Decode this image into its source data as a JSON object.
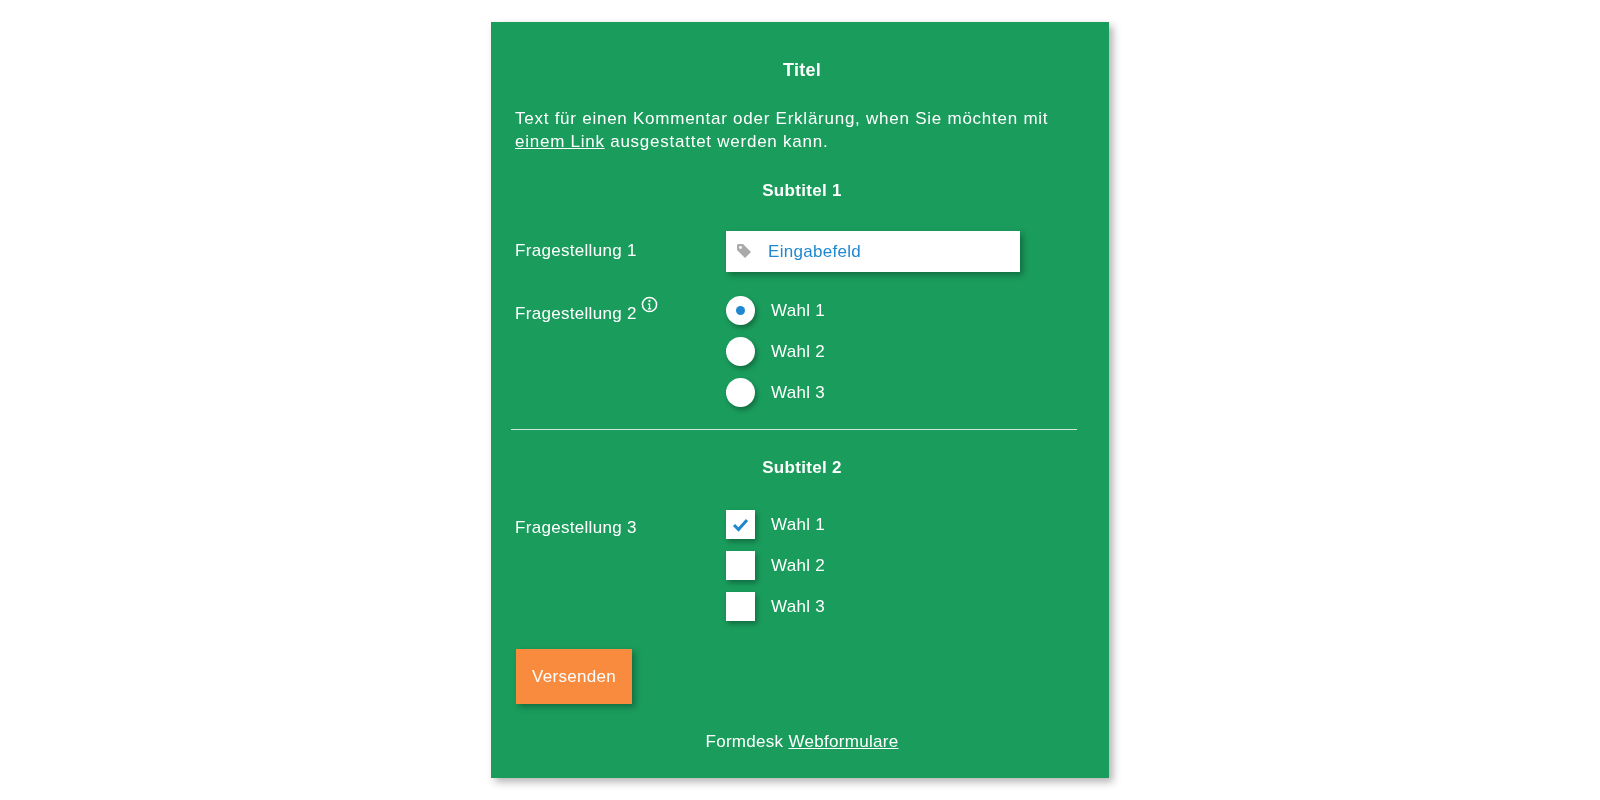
{
  "title": "Titel",
  "intro": {
    "before": "Text für einen Kommentar oder Erklärung, when Sie möchten mit ",
    "link": "einem Link",
    "after": " ausgestattet werden kann."
  },
  "sections": [
    {
      "subtitle": "Subtitel 1",
      "questions": [
        {
          "label": "Fragestellung 1",
          "kind": "text",
          "info": false,
          "placeholder": "Eingabefeld"
        },
        {
          "label": "Fragestellung 2",
          "kind": "radio",
          "info": true,
          "options": [
            {
              "label": "Wahl 1",
              "selected": true
            },
            {
              "label": "Wahl 2",
              "selected": false
            },
            {
              "label": "Wahl 3",
              "selected": false
            }
          ]
        }
      ]
    },
    {
      "subtitle": "Subtitel 2",
      "questions": [
        {
          "label": "Fragestellung 3",
          "kind": "checkbox",
          "info": false,
          "options": [
            {
              "label": "Wahl 1",
              "checked": true
            },
            {
              "label": "Wahl 2",
              "checked": false
            },
            {
              "label": "Wahl 3",
              "checked": false
            }
          ]
        }
      ]
    }
  ],
  "submit": "Versenden",
  "footer": {
    "text": "Formdesk",
    "link": "Webformulare"
  }
}
